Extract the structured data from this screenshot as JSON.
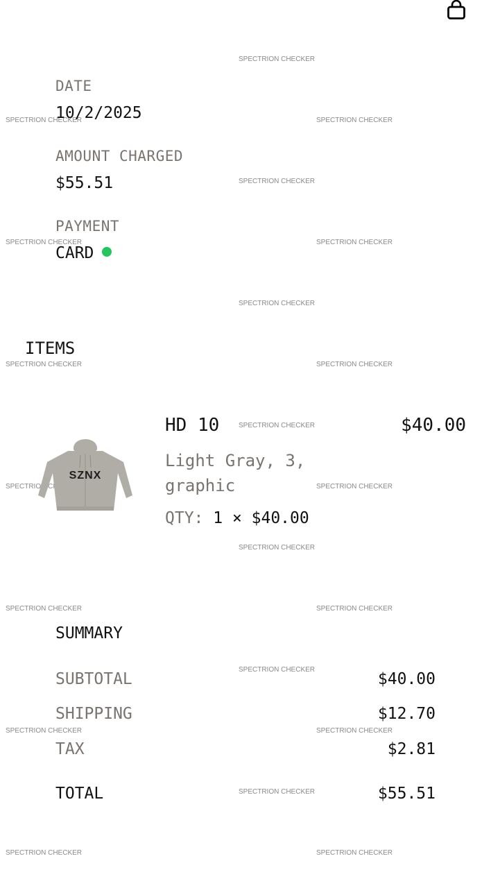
{
  "header": {
    "bag_icon": "shopping-bag-icon"
  },
  "watermark": "SPECTRION CHECKER",
  "details": {
    "date_label": "DATE",
    "date_value": "10/2/2025",
    "amount_label": "AMOUNT CHARGED",
    "amount_value": "$55.51",
    "payment_label": "PAYMENT",
    "payment_value": "CARD",
    "payment_status_color": "#22c55e"
  },
  "items": {
    "title": "ITEMS",
    "list": [
      {
        "name": "HD 10",
        "price": "$40.00",
        "variant": "Light Gray, 3, graphic",
        "qty_label": "QTY:",
        "qty_value": "1 × $40.00",
        "image_text": "SZNX",
        "image_color": "#b0aca6"
      }
    ]
  },
  "summary": {
    "title": "SUMMARY",
    "subtotal_label": "SUBTOTAL",
    "subtotal_value": "$40.00",
    "shipping_label": "SHIPPING",
    "shipping_value": "$12.70",
    "tax_label": "TAX",
    "tax_value": "$2.81",
    "total_label": "TOTAL",
    "total_value": "$55.51"
  }
}
